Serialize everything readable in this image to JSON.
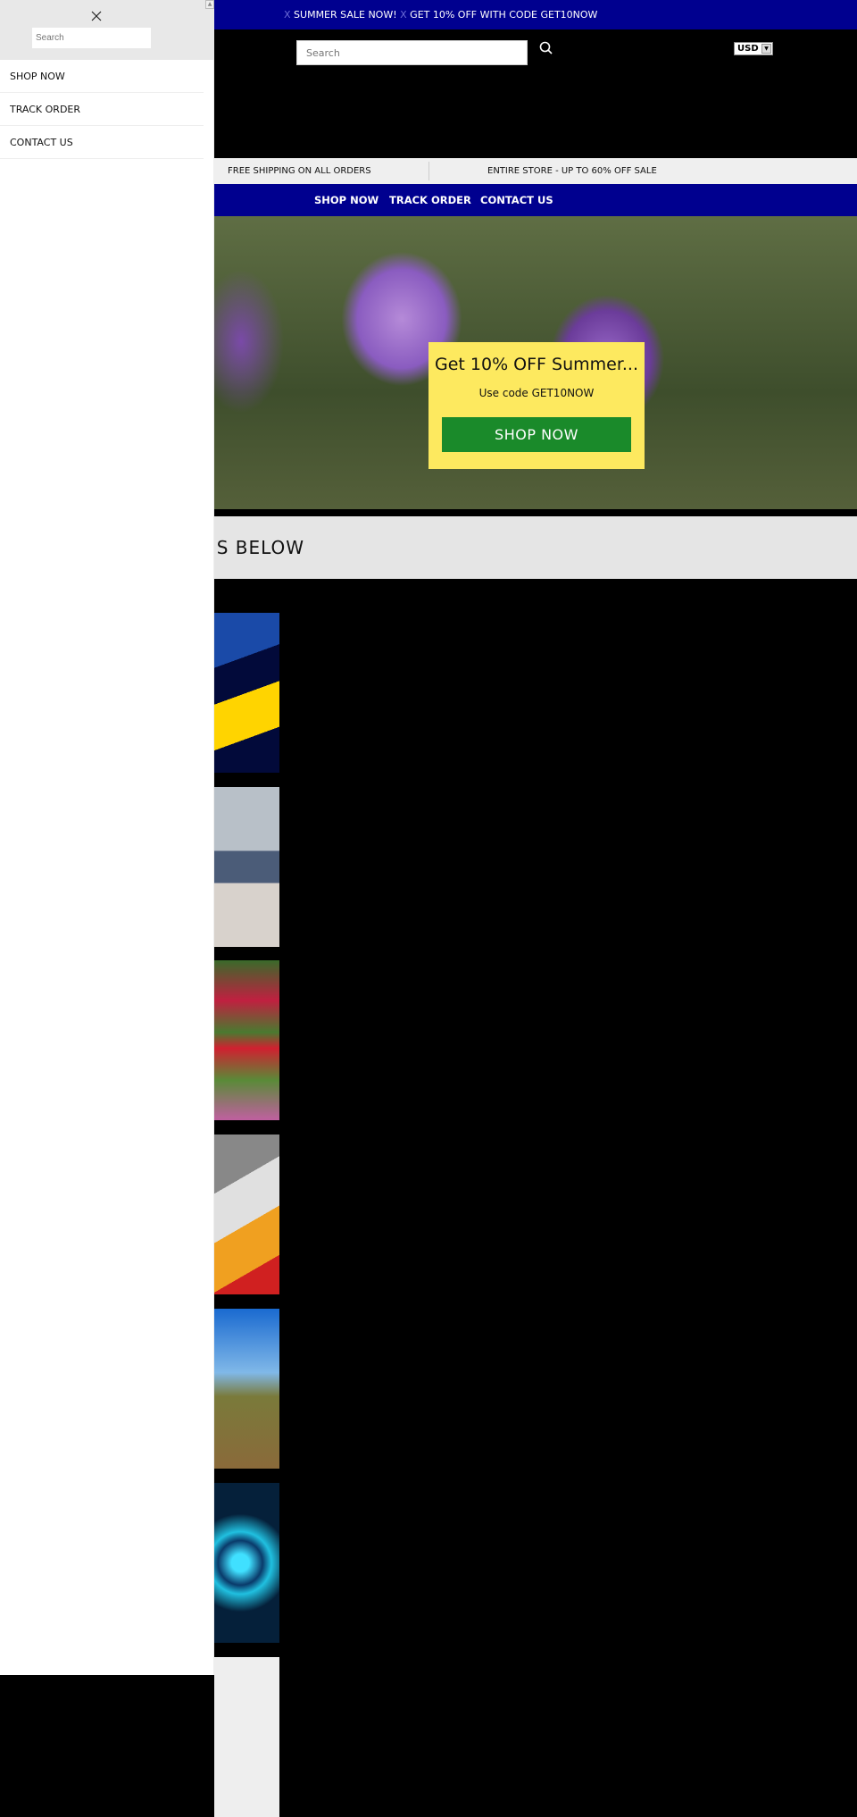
{
  "announcement": {
    "items": [
      "SUMMER SALE NOW!",
      "GET 10% OFF WITH CODE GET10NOW"
    ],
    "separator_glyph": "X"
  },
  "header": {
    "search_placeholder": "Search",
    "search_icon": "search-icon",
    "currency": "USD"
  },
  "strip": {
    "left": "FREE SHIPPING ON ALL ORDERS",
    "right": "ENTIRE STORE - UP TO 60% OFF SALE"
  },
  "nav": {
    "items": [
      "SHOP NOW",
      "TRACK ORDER",
      "CONTACT US"
    ]
  },
  "promo": {
    "title": "Get 10% OFF Summer...",
    "subtitle": "Use code GET10NOW",
    "button": "SHOP NOW"
  },
  "section": {
    "heading": "ONS BELOW"
  },
  "drawer": {
    "close_icon": "close-icon",
    "search_placeholder": "Search",
    "items": [
      "SHOP NOW",
      "TRACK ORDER",
      "CONTACT US"
    ]
  },
  "thumbnails": [
    "sale-banner",
    "kitchen",
    "garden",
    "tools",
    "hiking",
    "cyber-security",
    "partial"
  ],
  "colors": {
    "brand_blue": "#00008f",
    "promo_yellow": "#fde95f",
    "button_green": "#1a8a2a"
  }
}
